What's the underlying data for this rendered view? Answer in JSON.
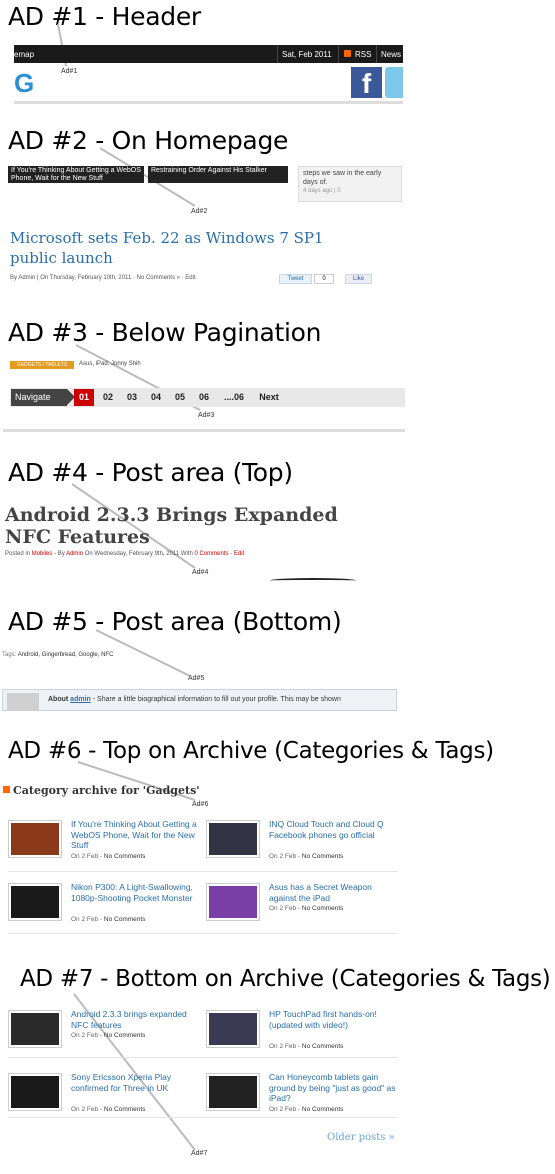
{
  "sections": [
    {
      "title": "AD #1 - Header",
      "ad_label": "Ad#1"
    },
    {
      "title": "AD #2 - On Homepage",
      "ad_label": "Ad#2"
    },
    {
      "title": "AD #3 - Below Pagination",
      "ad_label": "Ad#3"
    },
    {
      "title": "AD #4 - Post area (Top)",
      "ad_label": "Ad#4"
    },
    {
      "title": "AD #5 - Post area (Bottom)",
      "ad_label": "Ad#5"
    },
    {
      "title": "AD #6 - Top on Archive (Categories & Tags)",
      "ad_label": "Ad#6"
    },
    {
      "title": "AD #7 - Bottom on Archive (Categories & Tags)",
      "ad_label": "Ad#7"
    }
  ],
  "header": {
    "sitemap": "emap",
    "date": "Sat, Feb 2011",
    "rss": "RSS",
    "news": "News",
    "logo_letter": "G",
    "facebook_letter": "f"
  },
  "homepage": {
    "thumb1": "If You're Thinking About Getting a WebOS Phone, Wait for the New Stuff",
    "thumb2": "Restraining Order Against His Stalker",
    "side_text": "steps we saw in the early days of.",
    "side_meta": "4 days ago | 0",
    "post_title": "Microsoft sets Feb. 22 as Windows 7 SP1 public launch",
    "post_meta": "By Admin | On Thursday, February 10th, 2011 · No Comments » · Edit",
    "tweet": "Tweet",
    "count": "0",
    "like": "Like"
  },
  "pagination": {
    "category_tag": "GADGETS / TABLETS",
    "tags": "Asus, iPad, Jonny Shih",
    "navigate": "Navigate",
    "pages": [
      "01",
      "02",
      "03",
      "04",
      "05",
      "06",
      "....06",
      "Next"
    ],
    "active": "01"
  },
  "post_top": {
    "title": "Android 2.3.3 Brings Expanded NFC Features",
    "meta_prefix": "Posted in",
    "meta_cat": "Mobiles",
    "meta_by": "- By",
    "meta_author": "Admin",
    "meta_on": "On Wednesday, February 9th, 2011 With",
    "meta_comments": "0 Comments",
    "meta_edit": "Edit"
  },
  "post_bottom": {
    "tags_label": "Tags:",
    "tags": "Android, Gingerbread, Google, NFC",
    "about_label": "About",
    "about_name": "admin",
    "about_text": "- Share a little biographical information to fill out your profile. This may be shown"
  },
  "archive": {
    "heading": "Category archive for 'Gadgets'",
    "items_top": [
      {
        "title": "If You're Thinking About Getting a WebOS Phone, Wait for the New Stuff",
        "date": "On 2 Feb",
        "comments": "No Comments",
        "color": "#8a3a1a"
      },
      {
        "title": "INQ Cloud Touch and Cloud Q Facebook phones go official",
        "date": "On 2 Feb",
        "comments": "No Comments",
        "color": "#333344"
      },
      {
        "title": "Nikon P300: A Light-Swallowing, 1080p-Shooting Pocket Monster",
        "date": "On 2 Feb",
        "comments": "No Comments",
        "color": "#1a1a1a"
      },
      {
        "title": "Asus has a Secret Weapon against the iPad",
        "date": "On 2 Feb",
        "comments": "No Comments",
        "color": "#7a3fa6"
      }
    ],
    "items_bottom": [
      {
        "title": "Android 2.3.3 brings expanded NFC features",
        "date": "On 2 Feb",
        "comments": "No Comments",
        "color": "#2a2a2a"
      },
      {
        "title": "HP TouchPad first hands-on! (updated with video!)",
        "date": "On 2 Feb",
        "comments": "No Comments",
        "color": "#3a3a55"
      },
      {
        "title": "Sony Ericsson Xperia Play confirmed for Three in UK",
        "date": "On 2 Feb",
        "comments": "No Comments",
        "color": "#1a1a1a"
      },
      {
        "title": "Can Honeycomb tablets gain ground by being \"just as good\" as iPad?",
        "date": "On 2 Feb",
        "comments": "No Comments",
        "color": "#222222"
      }
    ],
    "older": "Older posts »",
    "separator": " - "
  }
}
